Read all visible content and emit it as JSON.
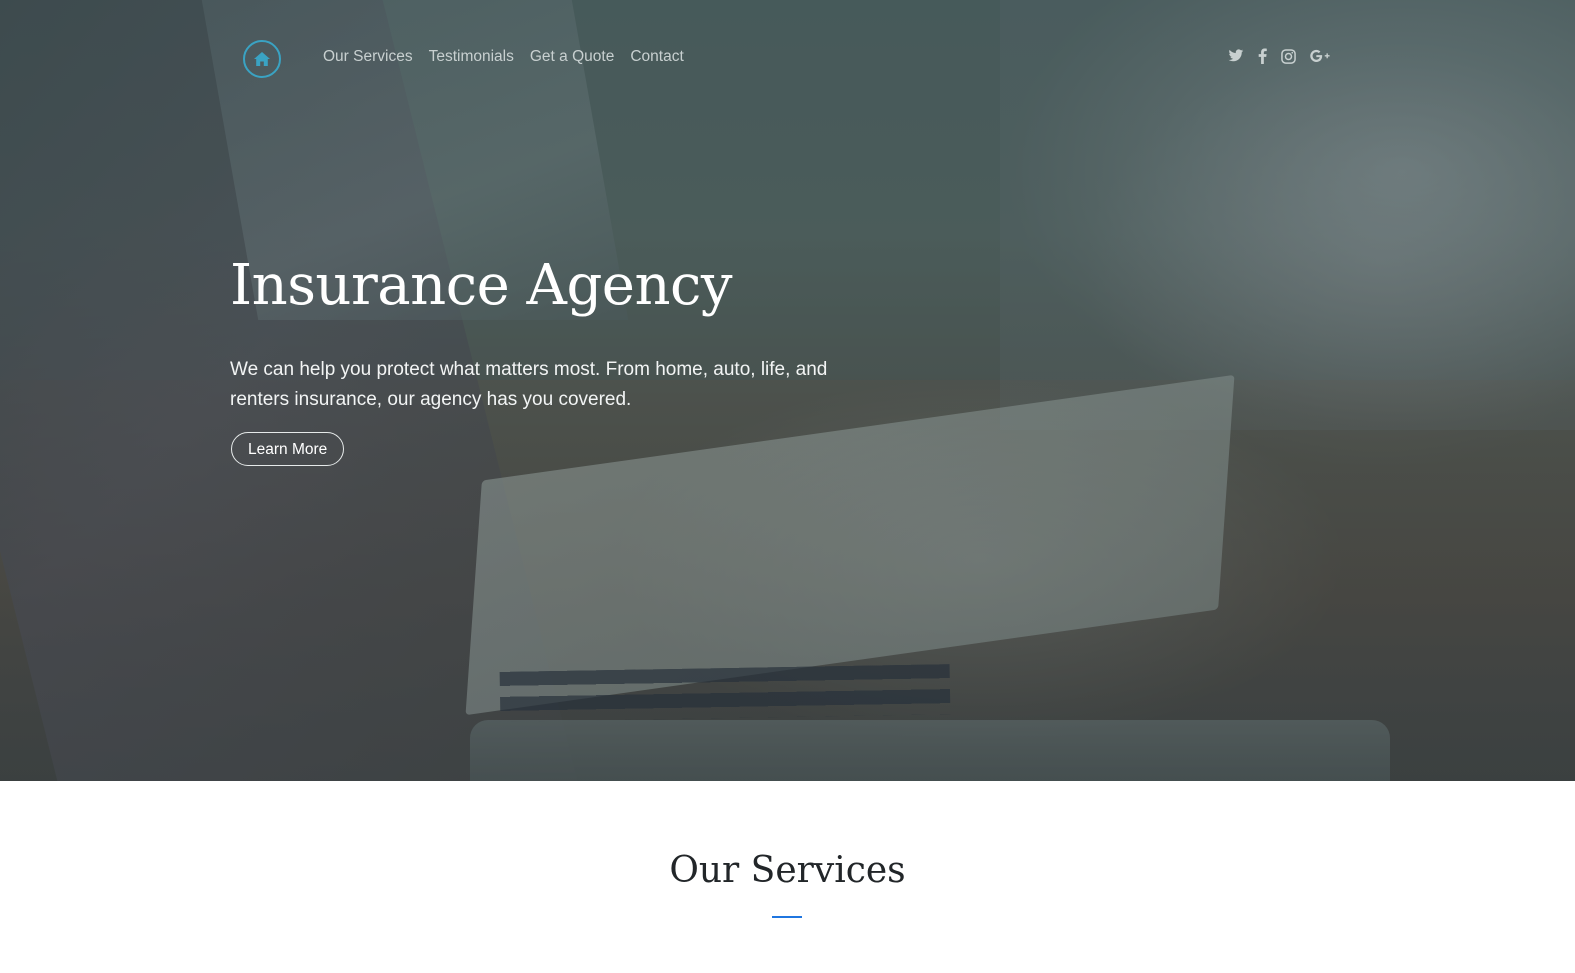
{
  "nav": {
    "home_icon": "home-icon",
    "links": [
      "Our Services",
      "Testimonials",
      "Get a Quote",
      "Contact"
    ],
    "social_icons": [
      "twitter-icon",
      "facebook-icon",
      "instagram-icon",
      "google-plus-icon"
    ]
  },
  "hero": {
    "title": "Insurance Agency",
    "subtitle": "We can help you protect what matters most. From home, auto, life, and renters insurance, our agency has you covered.",
    "cta_label": "Learn More"
  },
  "services": {
    "title": "Our Services"
  },
  "colors": {
    "accent": "#3aa3c3",
    "divider": "#1f76e0",
    "heading_dark": "#222629"
  }
}
